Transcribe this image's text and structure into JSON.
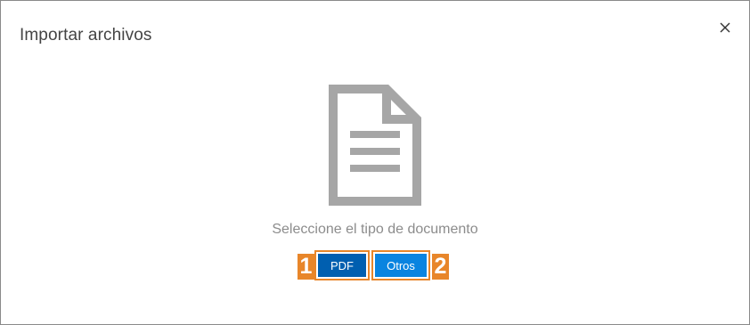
{
  "dialog": {
    "title": "Importar archivos",
    "close_icon": "close-icon"
  },
  "main": {
    "document_icon": "document-icon",
    "subtitle": "Seleccione el tipo de documento",
    "buttons": [
      {
        "label": "PDF",
        "callout": "1"
      },
      {
        "label": "Otros",
        "callout": "2"
      }
    ]
  },
  "colors": {
    "pdf_button": "#005fb0",
    "otros_button": "#0a84e0",
    "callout": "#e8862a",
    "icon_gray": "#a6a6a6"
  }
}
